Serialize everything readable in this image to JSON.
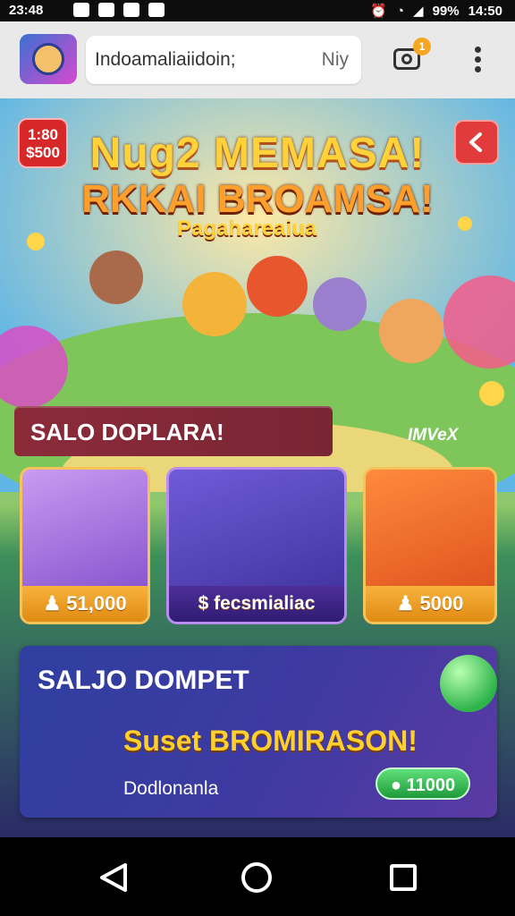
{
  "status_bar": {
    "time": "23:48",
    "battery": "99%",
    "clock": "14:50"
  },
  "app_bar": {
    "url_text": "Indoamaliaiidoin;",
    "url_suffix": "Niy",
    "notification_count": "1",
    "icons": [
      "app-icon",
      "camera-icon",
      "more-menu-icon"
    ]
  },
  "banner": {
    "balance_badge": [
      "1:80",
      "$500"
    ],
    "title_line1": "Nug2 MEMASA!",
    "title_line2": "RKKAI BROAMSA!",
    "subtitle": "Pagahareaiua"
  },
  "section": {
    "label": "SALO DOPLARA!",
    "brand": "IMVeX"
  },
  "cards": [
    {
      "label": "♟ 51,000"
    },
    {
      "label": "$ fecsmialiac"
    },
    {
      "label": "♟ 5000"
    }
  ],
  "wallet": {
    "title": "SALJO DOMPET",
    "promo": "Suset BROMIRASON!",
    "subtitle": "Dodlonanla",
    "amount": "● 11000"
  },
  "colors": {
    "accent": "#f6c25b",
    "banner_red": "#d62828",
    "panel_blue": "#2f3f9f"
  }
}
